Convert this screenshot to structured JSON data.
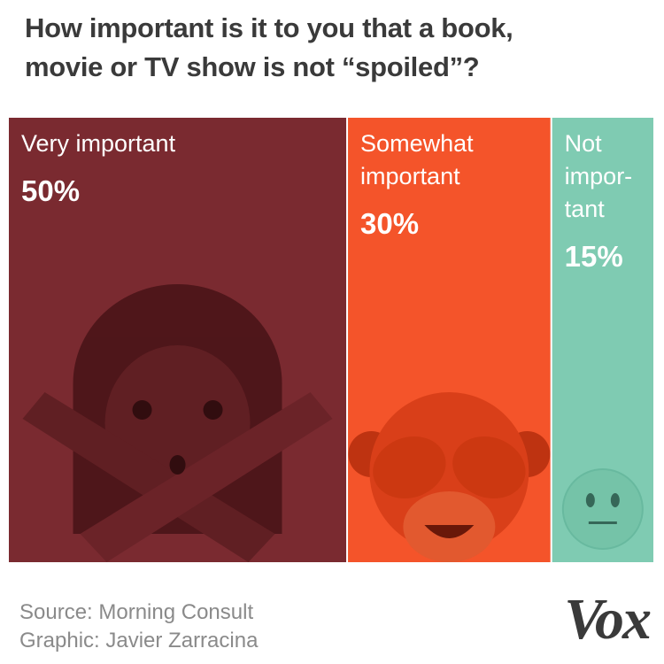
{
  "title": {
    "line1": "How important is it to you that a book,",
    "line2": "movie or TV show is not “spoiled”?"
  },
  "chart_data": {
    "type": "bar",
    "orientation": "stacked-horizontal",
    "categories": [
      "Very important",
      "Somewhat important",
      "Not important"
    ],
    "label_lines": [
      [
        "Very important"
      ],
      [
        "Somewhat",
        "important"
      ],
      [
        "Not",
        "impor-",
        "tant"
      ]
    ],
    "values": [
      50,
      30,
      15
    ],
    "value_labels": [
      "50%",
      "30%",
      "15%"
    ],
    "colors": [
      "#7a2a30",
      "#f4542a",
      "#7fcbb2"
    ],
    "icons": [
      "crossed-arms-emoji-icon",
      "see-no-evil-monkey-icon",
      "neutral-face-icon"
    ],
    "title": "How important is it to you that a book, movie or TV show is not “spoiled”?"
  },
  "footer": {
    "source": "Source: Morning Consult",
    "graphic": "Graphic: Javier Zarracina",
    "logo": "Vox"
  }
}
